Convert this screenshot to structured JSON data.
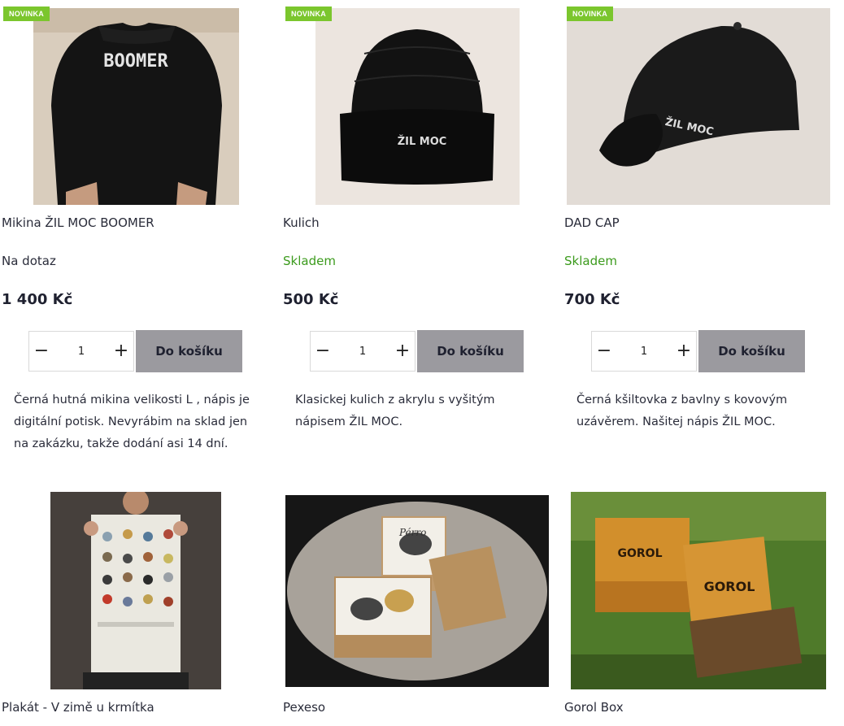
{
  "badge_label": "NOVINKA",
  "cart_label": "Do košíku",
  "qty_minus": "−",
  "qty_plus": "+",
  "products": [
    {
      "title": "Mikina ŽIL MOC BOOMER",
      "stock": "Na dotaz",
      "price": "1 400 Kč",
      "qty": "1",
      "description": "Černá hutná mikina velikosti L , nápis je digitální potisk. Nevyrábim na sklad jen na zakázku, takže dodání asi 14 dní.",
      "image_text": "BOOMER"
    },
    {
      "title": "Kulich",
      "stock": "Skladem",
      "price": "500 Kč",
      "qty": "1",
      "description": "Klasickej kulich z akrylu s vyšitým nápisem ŽIL MOC.",
      "image_text": "ŽIL MOC"
    },
    {
      "title": "DAD CAP",
      "stock": "Skladem",
      "price": "700 Kč",
      "qty": "1",
      "description": "Černá kšiltovka z bavlny s kovovým uzávěrem. Našitej nápis ŽIL MOC.",
      "image_text": "ŽIL MOC"
    },
    {
      "title": "Plakát - V zimě u krmítka"
    },
    {
      "title": "Pexeso",
      "image_text": "Pérro"
    },
    {
      "title": "Gorol Box",
      "image_text": "GOROL"
    }
  ],
  "colors": {
    "badge": "#7bc62d",
    "in_stock": "#3c9b1d",
    "cart_button": "#9b9a9f"
  }
}
